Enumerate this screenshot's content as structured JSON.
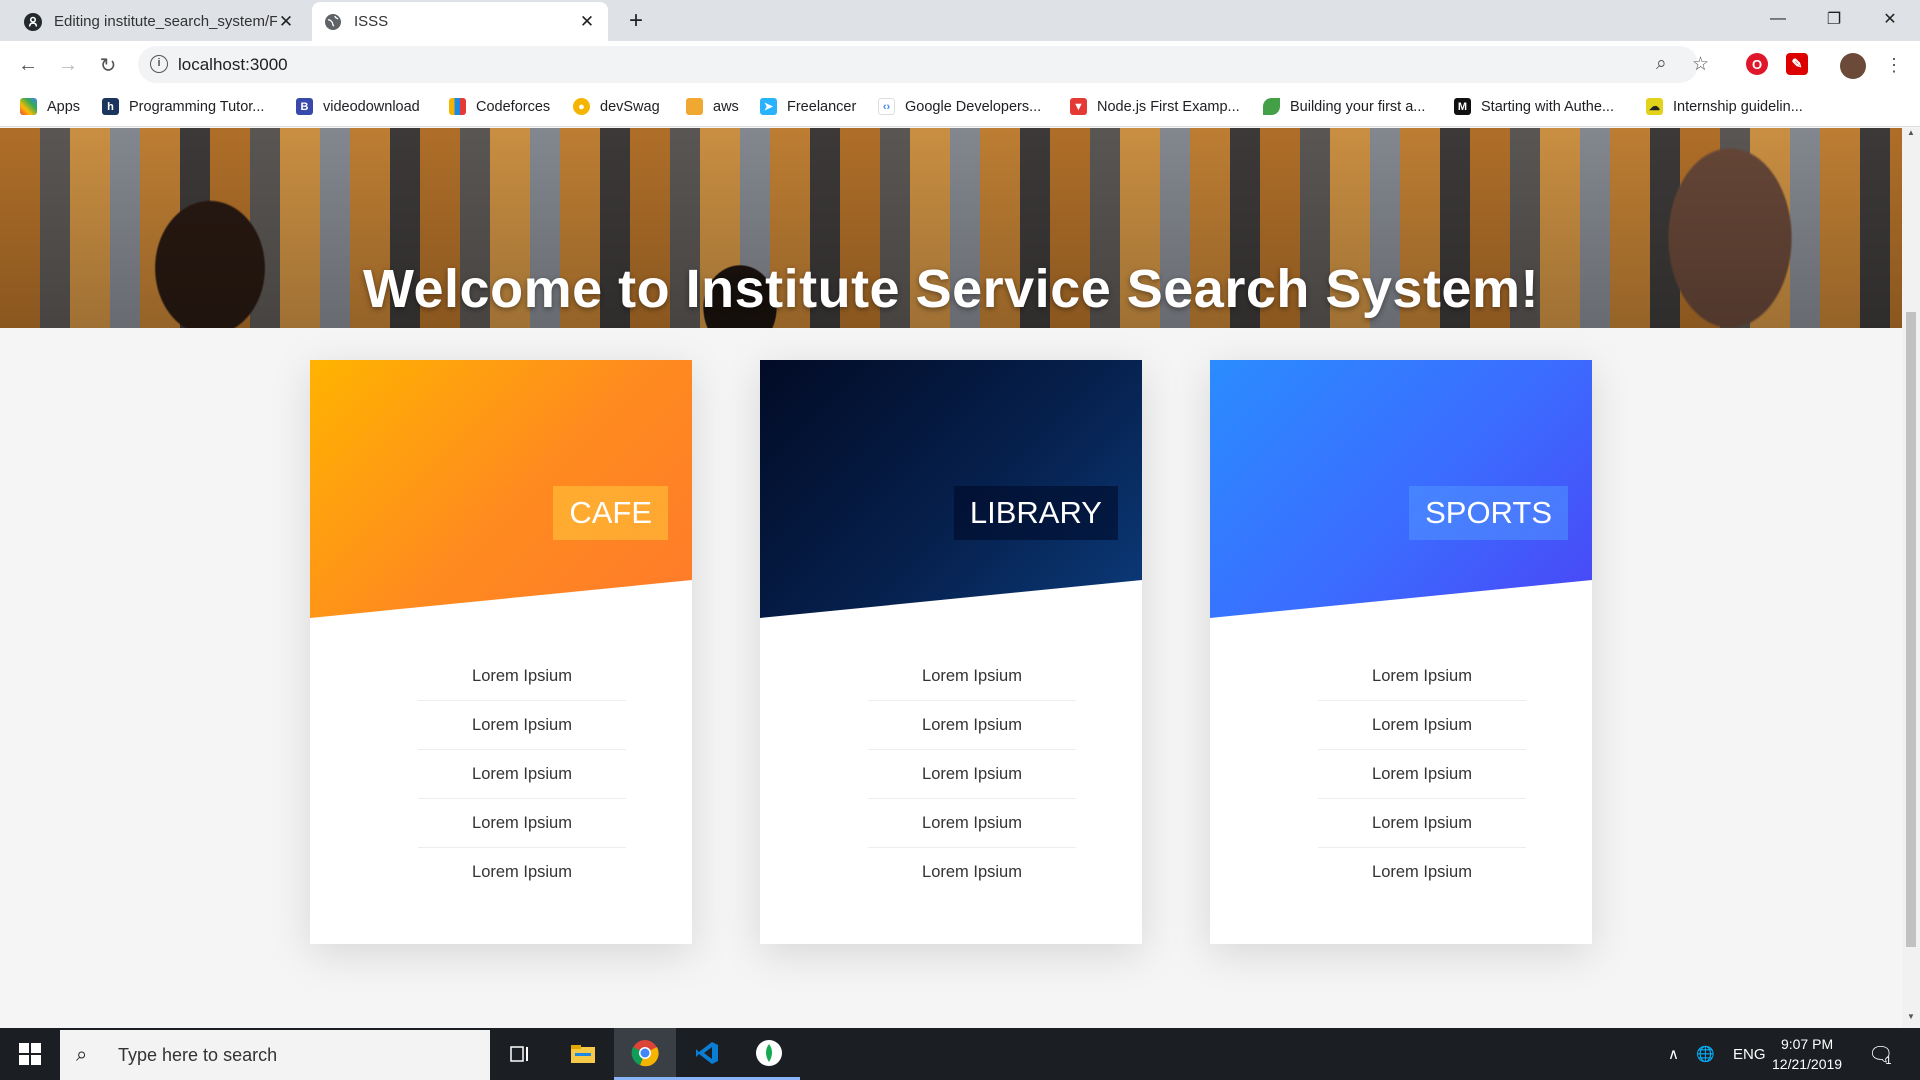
{
  "browser": {
    "tabs": [
      {
        "title": "Editing institute_search_system/F",
        "icon": "github-icon",
        "active": false
      },
      {
        "title": "ISSS",
        "icon": "globe-icon",
        "active": true
      }
    ],
    "new_tab": "+",
    "address": "localhost:3000",
    "bookmarks": [
      {
        "label": "Apps",
        "icon": "apps-grid-icon",
        "color": "#4285f4"
      },
      {
        "label": "Programming Tutor...",
        "icon": "h-icon",
        "color": "#1b365d"
      },
      {
        "label": "videodownload",
        "icon": "b-icon",
        "color": "#3949ab"
      },
      {
        "label": "Codeforces",
        "icon": "codeforces-icon",
        "color": "#f4b400"
      },
      {
        "label": "devSwag",
        "icon": "sunglasses-icon",
        "color": "#f4b400"
      },
      {
        "label": "aws",
        "icon": "cube-icon",
        "color": "#f0a830"
      },
      {
        "label": "Freelancer",
        "icon": "freelancer-icon",
        "color": "#29b2fe"
      },
      {
        "label": "Google Developers...",
        "icon": "google-dev-icon",
        "color": "#4285f4"
      },
      {
        "label": "Node.js First Examp...",
        "icon": "triangle-icon",
        "color": "#e53935"
      },
      {
        "label": "Building your first a...",
        "icon": "leaf-icon",
        "color": "#43a047"
      },
      {
        "label": "Starting with Authe...",
        "icon": "medium-icon",
        "color": "#111111"
      },
      {
        "label": "Internship guidelin...",
        "icon": "cloud-icon",
        "color": "#e3d21a"
      }
    ]
  },
  "page": {
    "hero_title": "Welcome to Institute Service Search System!",
    "cards": [
      {
        "title": "CAFE",
        "gradient": [
          "#ffb300",
          "#ff8a1f",
          "#ff7a2b"
        ],
        "tag_bg": "rgba(255,200,60,0.55)",
        "items": [
          "Lorem Ipsium",
          "Lorem Ipsium",
          "Lorem Ipsium",
          "Lorem Ipsium",
          "Lorem Ipsium"
        ]
      },
      {
        "title": "LIBRARY",
        "gradient": [
          "#020b25",
          "#06204d",
          "#0b3b7a"
        ],
        "tag_bg": "rgba(0,10,40,0.6)",
        "items": [
          "Lorem Ipsium",
          "Lorem Ipsium",
          "Lorem Ipsium",
          "Lorem Ipsium",
          "Lorem Ipsium"
        ]
      },
      {
        "title": "SPORTS",
        "gradient": [
          "#2b8cff",
          "#3b6cff",
          "#4a46f5"
        ],
        "tag_bg": "rgba(80,150,255,0.55)",
        "items": [
          "Lorem Ipsium",
          "Lorem Ipsium",
          "Lorem Ipsium",
          "Lorem Ipsium",
          "Lorem Ipsium"
        ]
      }
    ]
  },
  "taskbar": {
    "search_placeholder": "Type here to search",
    "apps": [
      "task-view-icon",
      "file-explorer-icon",
      "chrome-icon",
      "vscode-icon",
      "mongodb-icon"
    ],
    "tray": {
      "language": "ENG",
      "time": "9:07 PM",
      "date": "12/21/2019",
      "notifications": "1"
    }
  }
}
